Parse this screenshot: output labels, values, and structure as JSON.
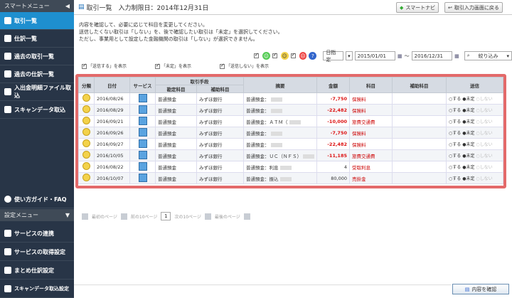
{
  "sidebar": {
    "header": "スマートメニュー",
    "items": [
      {
        "label": "取引一覧",
        "active": true
      },
      {
        "label": "仕訳一覧",
        "active": false
      },
      {
        "label": "過去の取引一覧",
        "active": false
      },
      {
        "label": "過去の仕訳一覧",
        "active": false
      },
      {
        "label": "入出金明細ファイル取込",
        "active": false
      },
      {
        "label": "スキャンデータ取込",
        "active": false
      }
    ],
    "guide": "使い方ガイド・FAQ",
    "settings_header": "設定メニュー",
    "settings_items": [
      "サービスの連携",
      "サービスの取得設定",
      "まとめ仕訳設定",
      "スキャンデータ取込設定"
    ]
  },
  "header": {
    "title": "取引一覧　入力制限日：2014年12月31日",
    "smart_navi": "スマートナビ",
    "back_button": "取引入力画面に戻る"
  },
  "info_lines": [
    "内容を確認して、必要に応じて科目を変更してください。",
    "送信したくない取引は「しない」を、後で確認したい取引は「未定」を選択してください。",
    "ただし、事業用として設定した金融機関の取引は「しない」が選択できません。"
  ],
  "filters": [
    {
      "label": "「送信する」を表示",
      "checked": true
    },
    {
      "label": "「未定」を表示",
      "checked": true
    },
    {
      "label": "「送信しない」を表示",
      "checked": true
    }
  ],
  "controls": {
    "date_mode": "日指定",
    "date_from": "2015/01/01",
    "date_sep": "～",
    "date_to": "2016/12/31",
    "narrow_button": "絞り込み"
  },
  "table": {
    "headers": {
      "category": "分類",
      "date": "日付",
      "service": "サービス",
      "transaction_means": "取引手段",
      "account": "勘定科目",
      "sub_account": "補助科目",
      "summary": "摘要",
      "amount": "金額",
      "subject": "科目",
      "sub_subject": "補助科目",
      "send": "送信"
    },
    "rows": [
      {
        "date": "2016/08/26",
        "account": "普通預金",
        "sub": "みずほ銀行",
        "summary": "普通預金：",
        "amount": "-7,750",
        "subject": "保険料",
        "send": "未定"
      },
      {
        "date": "2016/08/29",
        "account": "普通預金",
        "sub": "みずほ銀行",
        "summary": "普通預金：",
        "amount": "-22,482",
        "subject": "保険料",
        "send": "未定"
      },
      {
        "date": "2016/09/21",
        "account": "普通預金",
        "sub": "みずほ銀行",
        "summary": "普通預金：ＡＴＭ（",
        "amount": "-10,000",
        "subject": "旅費交通費",
        "send": "未定"
      },
      {
        "date": "2016/09/26",
        "account": "普通預金",
        "sub": "みずほ銀行",
        "summary": "普通預金：",
        "amount": "-7,750",
        "subject": "保険料",
        "send": "未定"
      },
      {
        "date": "2016/09/27",
        "account": "普通預金",
        "sub": "みずほ銀行",
        "summary": "普通預金：",
        "amount": "-22,482",
        "subject": "保険料",
        "send": "未定"
      },
      {
        "date": "2016/10/05",
        "account": "普通預金",
        "sub": "みずほ銀行",
        "summary": "普通預金：ＵＣ（ＮＦＳ）",
        "amount": "-11,185",
        "subject": "旅費交通費",
        "send": "未定"
      },
      {
        "date": "2016/08/22",
        "account": "普通預金",
        "sub": "みずほ銀行",
        "summary": "普通預金：利息",
        "amount": "4",
        "subject": "受取利息",
        "send": "未定"
      },
      {
        "date": "2016/10/07",
        "account": "普通預金",
        "sub": "みずほ銀行",
        "summary": "普通預金：振込",
        "amount": "80,000",
        "subject": "売掛金",
        "send": "未定"
      }
    ],
    "send_options": [
      "する",
      "未定",
      "しない"
    ]
  },
  "pager": {
    "first": "最初のページ",
    "prev": "前の10ページ",
    "current": "1",
    "next": "次の10ページ",
    "last": "最後のページ"
  },
  "confirm_button": "内容を確認"
}
